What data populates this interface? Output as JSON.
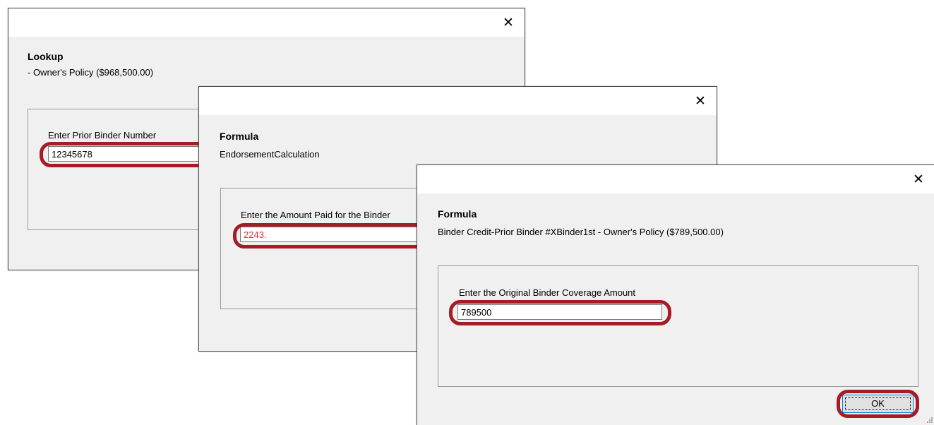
{
  "dialog_lookup": {
    "close_glyph": "✕",
    "heading": "Lookup",
    "subheading": "- Owner's Policy ($968,500.00)",
    "field_label": "Enter Prior Binder Number",
    "field_value": "12345678"
  },
  "dialog_formula_1": {
    "close_glyph": "✕",
    "heading": "Formula",
    "subheading": "EndorsementCalculation",
    "field_label": "Enter the Amount Paid for the Binder",
    "field_value": "2243."
  },
  "dialog_formula_2": {
    "close_glyph": "✕",
    "heading": "Formula",
    "subheading": "Binder Credit-Prior Binder #XBinder1st - Owner's Policy ($789,500.00)",
    "field_label": "Enter the Original Binder Coverage Amount",
    "field_value": "789500",
    "ok_label": "OK"
  },
  "colors": {
    "highlight": "#a51c24",
    "invalid_value": "#d8323c",
    "dialog_bg": "#f0f0f0",
    "titlebar_bg": "#ffffff"
  }
}
